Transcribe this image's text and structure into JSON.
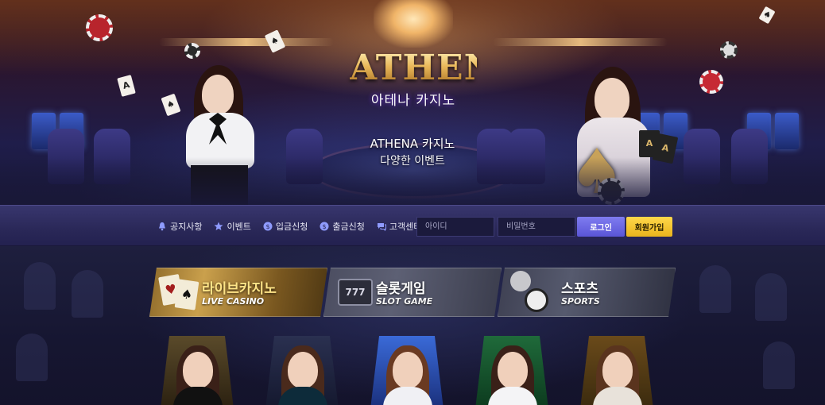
{
  "brand": {
    "logo_text": "ATHENA",
    "logo_subtitle": "아테나 카지노"
  },
  "hero": {
    "line1": "ATHENA 카지노",
    "line2": "다양한 이벤트"
  },
  "nav": {
    "items": [
      {
        "label": "공지사항",
        "icon": "bell-icon"
      },
      {
        "label": "이벤트",
        "icon": "star-icon"
      },
      {
        "label": "입금신청",
        "icon": "coin-in-icon"
      },
      {
        "label": "출금신청",
        "icon": "coin-out-icon"
      },
      {
        "label": "고객센터",
        "icon": "chat-icon"
      }
    ],
    "id_placeholder": "아이디",
    "pw_placeholder": "비밀번호",
    "login_label": "로그인",
    "join_label": "회원가입"
  },
  "categories": [
    {
      "title": "라이브카지노",
      "subtitle": "LIVE CASINO"
    },
    {
      "title": "슬롯게임",
      "subtitle": "SLOT GAME"
    },
    {
      "title": "스포츠",
      "subtitle": "SPORTS"
    }
  ],
  "colors": {
    "accent_gold": "#e9b85a",
    "login_button": "#6c68e6",
    "join_button": "#f5c62f",
    "navbar": "#2a2858"
  }
}
